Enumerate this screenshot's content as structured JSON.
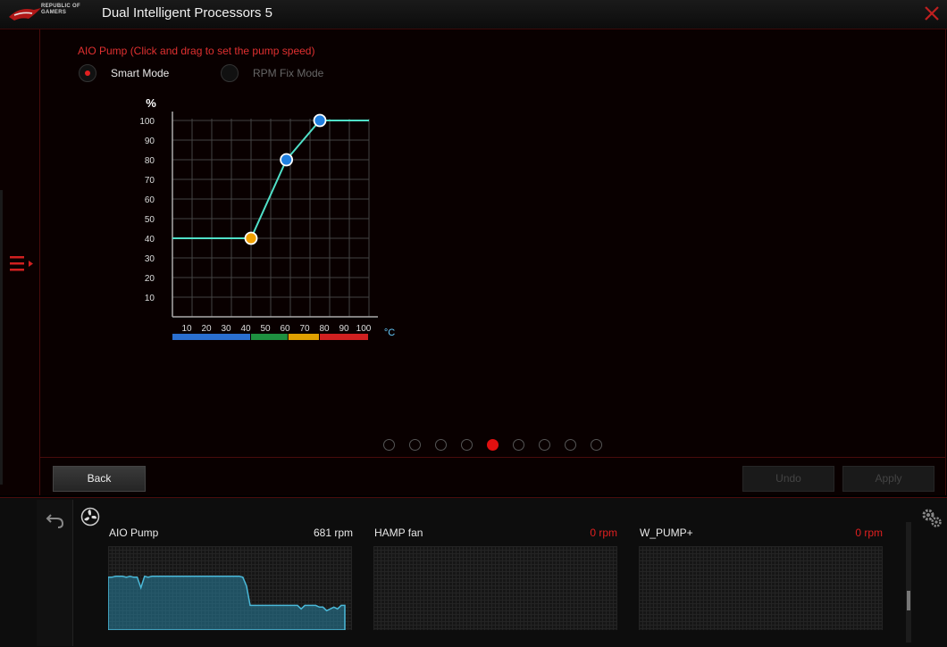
{
  "app": {
    "title": "Dual Intelligent Processors 5",
    "logo_text_1": "REPUBLIC OF",
    "logo_text_2": "GAMERS"
  },
  "panel": {
    "pump_title": "AIO Pump (Click and drag to set the pump speed)",
    "mode_smart": "Smart Mode",
    "mode_rpm": "RPM Fix Mode",
    "selected_mode": "Smart Mode"
  },
  "chart_data": {
    "type": "line",
    "ylabel": "%",
    "xlabel": "°C",
    "x_ticks": [
      10,
      20,
      30,
      40,
      50,
      60,
      70,
      80,
      90,
      100
    ],
    "y_ticks": [
      10,
      20,
      30,
      40,
      50,
      60,
      70,
      80,
      90,
      100
    ],
    "xlim": [
      0,
      100
    ],
    "ylim": [
      0,
      100
    ],
    "grid": true,
    "series": [
      {
        "points": [
          [
            0,
            40
          ],
          [
            40,
            40
          ],
          [
            58,
            80
          ],
          [
            75,
            100
          ],
          [
            100,
            100
          ]
        ]
      }
    ],
    "control_points": [
      {
        "x": 40,
        "y": 40,
        "color": "#f0a000"
      },
      {
        "x": 58,
        "y": 80,
        "color": "#2080e0"
      },
      {
        "x": 75,
        "y": 100,
        "color": "#2080e0"
      }
    ],
    "temp_zones": [
      {
        "from": 0,
        "to": 40,
        "color": "#2a6fd0"
      },
      {
        "from": 40,
        "to": 59,
        "color": "#1e9040"
      },
      {
        "from": 59,
        "to": 75,
        "color": "#e0a000"
      },
      {
        "from": 75,
        "to": 100,
        "color": "#d02020"
      }
    ]
  },
  "pager": {
    "count": 9,
    "active": 4
  },
  "buttons": {
    "back": "Back",
    "undo": "Undo",
    "apply": "Apply"
  },
  "monitor": {
    "fans": [
      {
        "name": "AIO Pump",
        "value": "681 rpm",
        "value_color": "#e8e8e8",
        "history": [
          60,
          60,
          61,
          61,
          61,
          60,
          61,
          60,
          60,
          48,
          61,
          60,
          61,
          61,
          61,
          61,
          61,
          61,
          61,
          61,
          61,
          61,
          61,
          61,
          61,
          61,
          61,
          61,
          61,
          61,
          61,
          61,
          61,
          61,
          61,
          61,
          61,
          60,
          50,
          28,
          28,
          28,
          28,
          28,
          28,
          28,
          28,
          28,
          28,
          28,
          28,
          28,
          28,
          24,
          28,
          28,
          28,
          28,
          26,
          26,
          22,
          24,
          26,
          24,
          28,
          28
        ]
      },
      {
        "name": "HAMP fan",
        "value": "0 rpm",
        "value_color": "#e02020",
        "history": []
      },
      {
        "name": "W_PUMP+",
        "value": "0 rpm",
        "value_color": "#e02020",
        "history": []
      }
    ]
  },
  "colors": {
    "accent": "#e02020",
    "curve": "#50e0c8",
    "panel_bg": "#090000"
  }
}
